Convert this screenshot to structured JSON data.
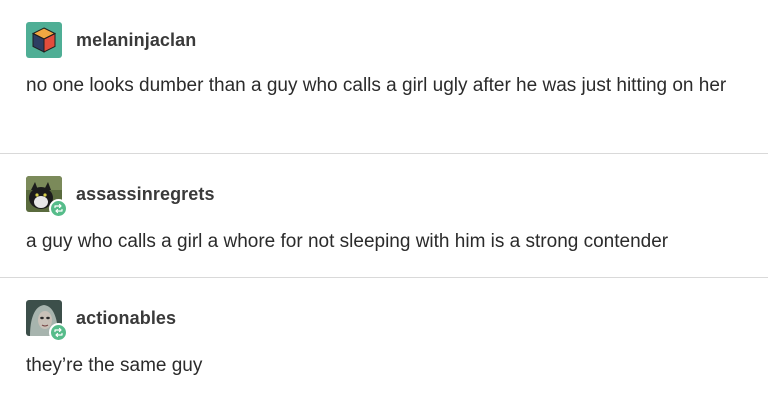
{
  "posts": [
    {
      "username": "melaninjaclan",
      "avatar_icon": "cube-icon",
      "text": "no one looks dumber than a guy who calls a girl ugly after he was just hitting on her",
      "is_reblog": false
    },
    {
      "username": "assassinregrets",
      "avatar_icon": "cat-photo",
      "text": "a guy who calls a girl a whore for not sleeping with him is a strong contender",
      "is_reblog": true,
      "reblog_icon": "reblog-icon"
    },
    {
      "username": "actionables",
      "avatar_icon": "portrait-photo",
      "text": "they’re the same guy",
      "is_reblog": true,
      "reblog_icon": "reblog-icon"
    }
  ],
  "colors": {
    "reblog_badge": "#56bc8a",
    "divider": "#d9d9d9",
    "text": "#2b2b2b"
  }
}
